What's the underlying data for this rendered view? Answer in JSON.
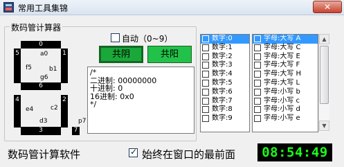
{
  "window": {
    "title": "常用工具集锦",
    "close_label": "✕"
  },
  "group_title": "数码管计算器",
  "auto": {
    "label": "自动（0~9）",
    "checked": false
  },
  "mode_buttons": {
    "common_cathode": "共阴",
    "common_anode": "共阳"
  },
  "seg_labels": {
    "n0": "0",
    "n5": "5",
    "n1": "1",
    "n6": "6",
    "n4": "4",
    "n2": "2",
    "n3": "3",
    "n7": "7",
    "a0": "a0",
    "b1": "b1",
    "f5": "f5",
    "g6": "g6",
    "e4": "e4",
    "c2": "c2",
    "d3": "d3",
    "p7": "p7"
  },
  "output": {
    "line1": "/*",
    "line2": "二进制: 00000000",
    "line3": "十进制: 0",
    "line4": "16进制: 0x0",
    "line5": "*/"
  },
  "digits_list": [
    "数字:0",
    "数字:1",
    "数字:2",
    "数字:3",
    "数字:4",
    "数字:5",
    "数字:6",
    "数字:7",
    "数字:8",
    "数字:9"
  ],
  "letters_list": [
    "字母:大写 A",
    "字母:大写 C",
    "字母:大写 E",
    "字母:大写 F",
    "字母:大写 H",
    "字母:大写 L",
    "字母:小写 b",
    "字母:小写 c",
    "字母:小写 d",
    "字母:小写 e"
  ],
  "footer": {
    "app_name": "数码管计算软件",
    "always_on_top": "始终在窗口的最前面",
    "always_on_top_checked": true
  },
  "clock": "08:54:49"
}
